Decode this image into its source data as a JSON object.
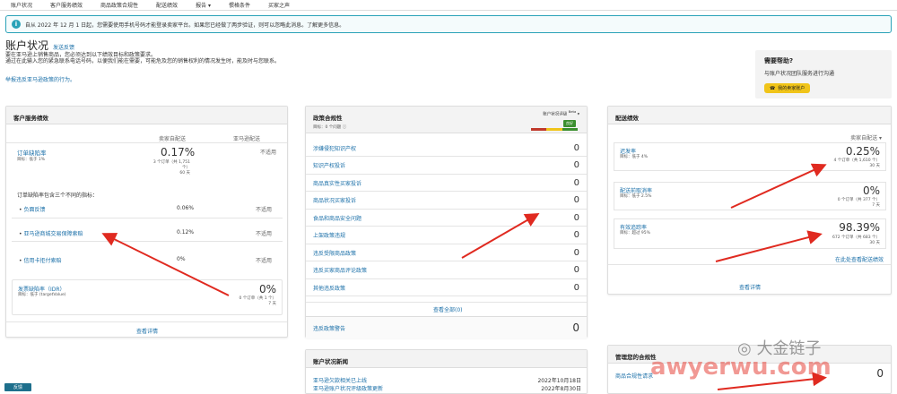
{
  "nav": [
    "账户状况",
    "客户服务绩效",
    "商品政策合规性",
    "配送绩效",
    "报告 ▾",
    "惯格条件",
    "买家之声"
  ],
  "notice": "自从 2022 年 12 月 1 日起，您需要使用手机号码才能登录卖家平台。如果您已经做了两步验证，则可以忽略此消息。了解更多信息。",
  "title": "账户状况",
  "title_link": "发送反馈",
  "intro": [
    "要在亚马逊上销售商品，您必须达到以下绩效目标和政策要求。",
    "通过在此输入您的紧急联系电话号码，以便我们能在需要，可能危及您的销售权利的情况发生时，能及时与您联系。",
    "举报违反亚马逊政策的行为。"
  ],
  "help": {
    "title": "需要帮助?",
    "text": "与账户状况团队服务进行沟通",
    "button": "我的卖家账户"
  },
  "cs": {
    "title": "客户服务绩效",
    "col1": "卖家自配送",
    "col2": "亚马逊配送",
    "odr_label": "订单缺陷率",
    "odr_target": "目标：低于 1%",
    "odr_value": "0.17%",
    "odr_sub": [
      "3 个订单（共 1,751",
      "个）",
      "60 天"
    ],
    "odr_fba": "不适用",
    "breakdown": "订单缺陷率包含三个不同的指标：",
    "items": [
      {
        "label": "负面反馈",
        "v1": "0.06%",
        "v2": "不适用"
      },
      {
        "label": "亚马逊商城交易保障索赔",
        "v1": "0.12%",
        "v2": "不适用"
      },
      {
        "label": "信用卡拒付索赔",
        "v1": "0%",
        "v2": "不适用"
      }
    ],
    "idr_label": "发票缺陷率（IDR）",
    "idr_target": "目标：低于 (targetValue)",
    "idr_value": "0%",
    "idr_sub": [
      "0 个订单（共 1 个）",
      "7 天"
    ],
    "link": "查看详情"
  },
  "policy": {
    "title": "政策合规性",
    "sub": "目标：0 个问题 ⓘ",
    "status_label": "账户状况评级",
    "beta": "Beta",
    "status": "良好",
    "items": [
      {
        "label": "涉嫌侵犯知识产权",
        "v": "0"
      },
      {
        "label": "知识产权投诉",
        "v": "0"
      },
      {
        "label": "商品真实性买家投诉",
        "v": "0"
      },
      {
        "label": "商品状况买家投诉",
        "v": "0"
      },
      {
        "label": "食品和商品安全问题",
        "v": "0"
      },
      {
        "label": "上架政策违规",
        "v": "0"
      },
      {
        "label": "违反受限商品政策",
        "v": "0"
      },
      {
        "label": "违反买家商品评论政策",
        "v": "0"
      },
      {
        "label": "其他违反政策",
        "v": "0"
      }
    ],
    "all": "查看全部(0)",
    "warning_label": "违反政策警告",
    "warning_value": "0"
  },
  "news": {
    "title": "账户状况新闻",
    "items": [
      {
        "label": "亚马逊欠款相关已上线",
        "date": "2022年10月18日"
      },
      {
        "label": "亚马逊账户状况评级政策更新",
        "date": "2022年8月30日"
      }
    ]
  },
  "ship": {
    "title": "配送绩效",
    "col": "卖家自配送 ▾",
    "items": [
      {
        "label": "迟发率",
        "target": "目标：低于 4%",
        "value": "0.25%",
        "sub": [
          "4 个订单（共 1,610 个）",
          "30 天"
        ]
      },
      {
        "label": "配送前取消率",
        "target": "目标：低于 2.5%",
        "value": "0%",
        "sub": [
          "0 个订单（共 377 个）",
          "7 天"
        ]
      },
      {
        "label": "有效追踪率",
        "target": "目标：超过 95%",
        "value": "98.39%",
        "sub": [
          "672 个订单（共 683 个）",
          "30 天"
        ]
      }
    ],
    "link1": "在此处查看配送绩效",
    "link2": "查看详情"
  },
  "mgmt": {
    "title": "管理您的合规性",
    "item": "商品合规性请求",
    "value": "0"
  },
  "watermark": {
    "name": "大金链子",
    "url": "awyerwu.com"
  },
  "footer": "反馈"
}
